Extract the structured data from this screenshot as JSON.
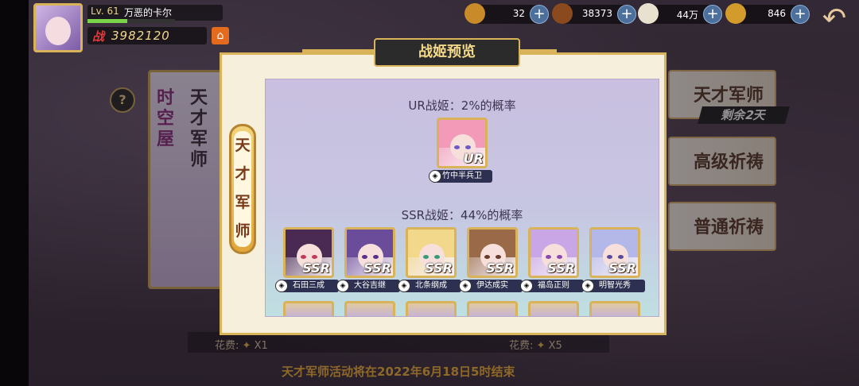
{
  "player": {
    "level": "Lv. 61",
    "name": "万恶的卡尔",
    "power_label": "战",
    "power_value": "3982120",
    "exp_fraction": 0.45
  },
  "resources": [
    {
      "icon": "gem-icon",
      "value": "32",
      "color": "#c98a2a"
    },
    {
      "icon": "coin-icon",
      "value": "38373",
      "color": "#8a4a1e"
    },
    {
      "icon": "rice-icon",
      "value": "44万",
      "color": "#e9e1d0"
    },
    {
      "icon": "gold-bar-icon",
      "value": "846",
      "color": "#d39a2c"
    }
  ],
  "background": {
    "side_banner_left": "时空屋",
    "side_banner_right": "天才军师",
    "options": [
      "天才军师",
      "高级祈祷",
      "普通祈祷"
    ],
    "remain": "剩余2天",
    "cost_left": "花费:",
    "cost_left_mult": "X1",
    "cost_right": "花费:",
    "cost_right_mult": "X5",
    "event_notice": "天才军师活动将在2022年6月18日5时结束"
  },
  "modal": {
    "title": "战姬预览",
    "tab_label": "天才军师",
    "ur_title": "UR战姬：2%的概率",
    "ur_cards": [
      {
        "name": "竹中半兵卫",
        "rank": "UR",
        "hair": "#f29ab8",
        "eye": "#6d5cc7"
      }
    ],
    "ssr_title": "SSR战姬：44%的概率",
    "ssr_cards": [
      {
        "name": "石田三成",
        "rank": "SSR",
        "hair": "#4a2a52",
        "eye": "#c23a5a"
      },
      {
        "name": "大谷吉继",
        "rank": "SSR",
        "hair": "#6a4c9a",
        "eye": "#5a2e8a"
      },
      {
        "name": "北条纲成",
        "rank": "SSR",
        "hair": "#f1d88a",
        "eye": "#3a9a7a"
      },
      {
        "name": "伊达成实",
        "rank": "SSR",
        "hair": "#9a6a48",
        "eye": "#6a3a2a"
      },
      {
        "name": "福岛正则",
        "rank": "SSR",
        "hair": "#c9a6e6",
        "eye": "#8a4ab0"
      },
      {
        "name": "明智光秀",
        "rank": "SSR",
        "hair": "#b4b8e8",
        "eye": "#5a4a9a"
      }
    ]
  }
}
